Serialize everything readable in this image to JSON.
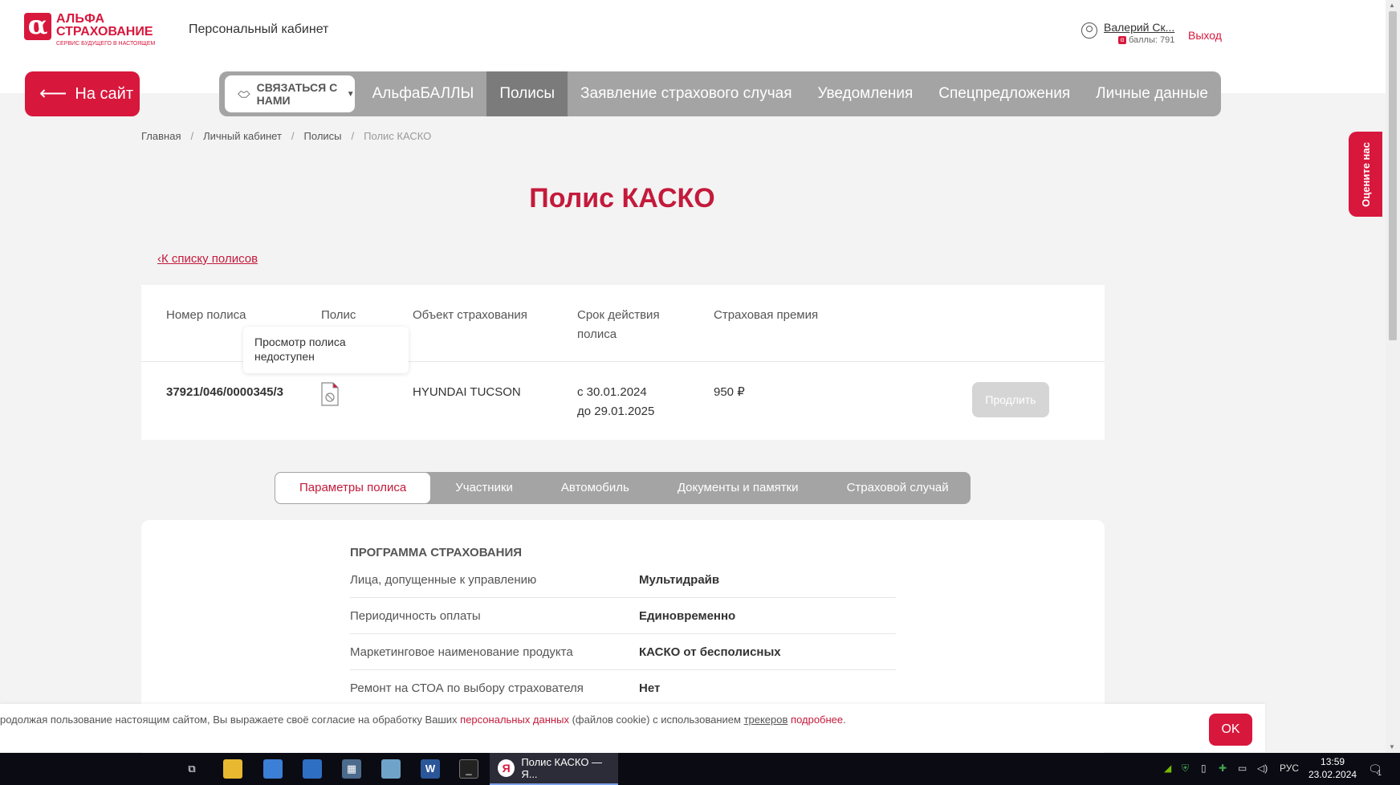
{
  "header": {
    "logo_line1": "АЛЬФА",
    "logo_line2": "СТРАХОВАНИЕ",
    "logo_tagline": "СЕРВИС БУДУЩЕГО В НАСТОЯЩЕМ",
    "cabinet_title": "Персональный кабинет",
    "user_name": "Валерий Ск...",
    "user_points": "баллы: 791",
    "logout": "Выход"
  },
  "nav": {
    "back_label": "На сайт",
    "contact_label": "СВЯЗАТЬСЯ С НАМИ",
    "items": [
      {
        "label": "АльфаБАЛЛЫ",
        "active": false
      },
      {
        "label": "Полисы",
        "active": true
      },
      {
        "label": "Заявление страхового случая",
        "active": false
      },
      {
        "label": "Уведомления",
        "active": false
      },
      {
        "label": "Спецпредложения",
        "active": false
      },
      {
        "label": "Личные данные",
        "active": false
      }
    ]
  },
  "breadcrumb": [
    "Главная",
    "Личный кабинет",
    "Полисы",
    "Полис КАСКО"
  ],
  "page_title": "Полис КАСКО",
  "back_link": "К списку полисов",
  "policy_table": {
    "headers": {
      "number": "Номер полиса",
      "policy": "Полис",
      "object": "Объект страхования",
      "term_line1": "Срок действия",
      "term_line2": "полиса",
      "premium": "Страховая премия"
    },
    "tooltip_line1": "Просмотр полиса",
    "tooltip_line2": "недоступен",
    "row": {
      "number": "37921/046/0000345/3",
      "object": "HYUNDAI TUCSON",
      "term_from": "с 30.01.2024",
      "term_to": "до 29.01.2025",
      "premium": "950 ₽",
      "renew_label": "Продлить"
    }
  },
  "tabs": [
    {
      "label": "Параметры полиса",
      "active": true
    },
    {
      "label": "Участники",
      "active": false
    },
    {
      "label": "Автомобиль",
      "active": false
    },
    {
      "label": "Документы и памятки",
      "active": false
    },
    {
      "label": "Страховой случай",
      "active": false
    }
  ],
  "params": {
    "section_title": "ПРОГРАММА СТРАХОВАНИЯ",
    "rows": [
      {
        "label": "Лица, допущенные к управлению",
        "value": "Мультидрайв"
      },
      {
        "label": "Периодичность оплаты",
        "value": "Единовременно"
      },
      {
        "label": "Маркетинговое наименование продукта",
        "value": "КАСКО от бесполисных"
      },
      {
        "label": "Ремонт на СТОА по выбору страхователя",
        "value": "Нет"
      }
    ]
  },
  "rate_tab": "Оцените нас",
  "cookie": {
    "text_part1": "родолжая пользование настоящим сайтом, Вы выражаете своё согласие на обработку Ваших ",
    "link1": "персональных данных",
    "text_part2": " (файлов cookie) с использованием ",
    "link2": "трекеров",
    "link3": "подробнее",
    "ok": "OK"
  },
  "taskbar": {
    "active_window": "Полис КАСКО — Я...",
    "lang": "РУС",
    "time": "13:59",
    "date": "23.02.2024",
    "notifications": "1"
  },
  "colors": {
    "brand_red": "#d8173c",
    "nav_gray": "#a4a4a4",
    "nav_active": "#7b7b7b"
  }
}
